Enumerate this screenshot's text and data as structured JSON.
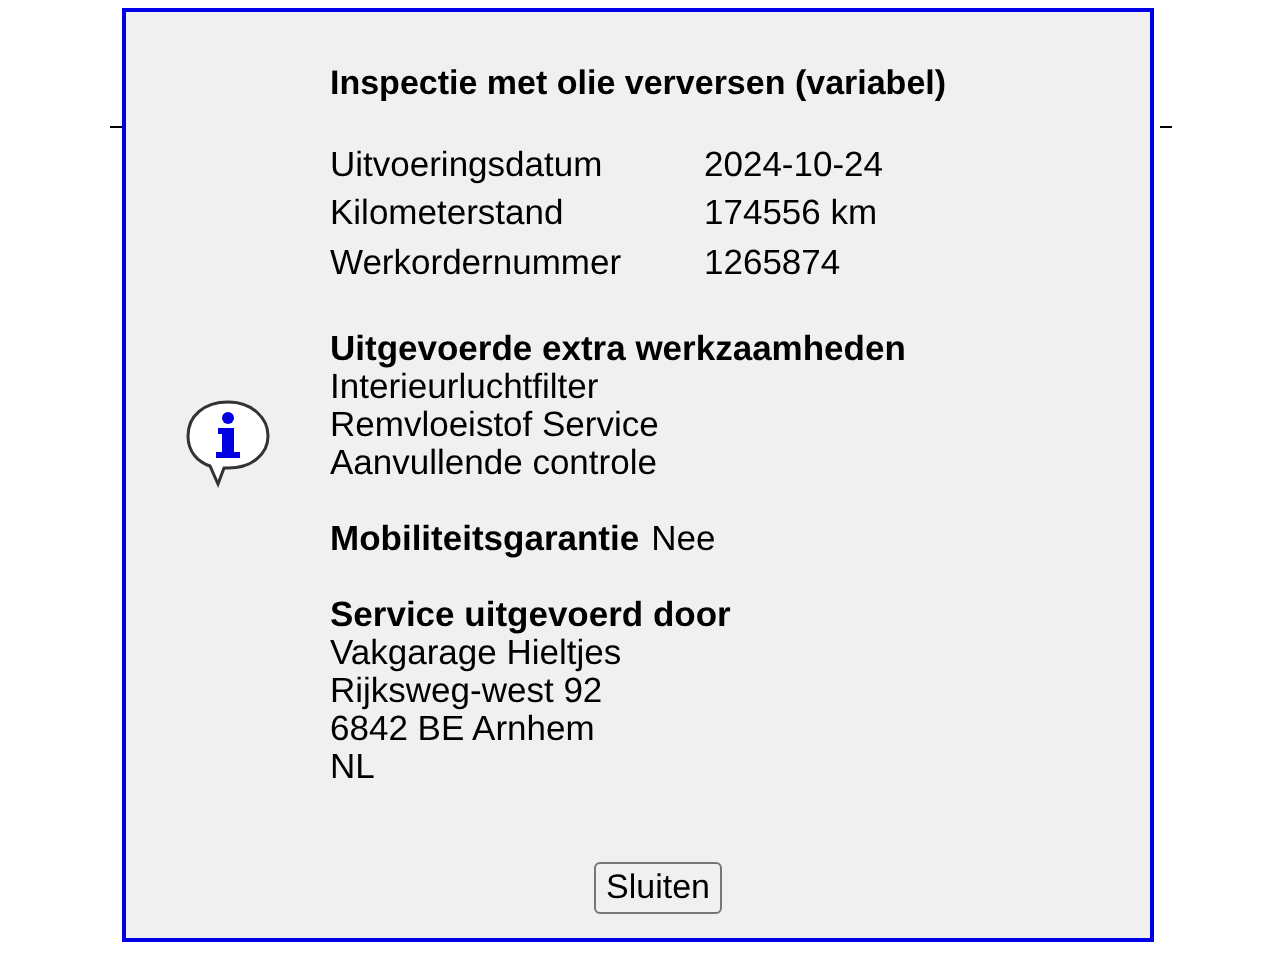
{
  "dialog": {
    "title": "Inspectie met olie verversen (variabel)",
    "details": [
      {
        "label": "Uitvoeringsdatum",
        "value": "2024-10-24"
      },
      {
        "label": "Kilometerstand",
        "value": "174556 km"
      },
      {
        "label": "Werkordernummer",
        "value": "1265874"
      }
    ],
    "extra_work": {
      "heading": "Uitgevoerde extra werkzaamheden",
      "items": [
        "Interieurluchtfilter",
        "Remvloeistof Service",
        "Aanvullende controle"
      ]
    },
    "mobility": {
      "label": "Mobiliteitsgarantie",
      "value": "Nee"
    },
    "service_by": {
      "heading": "Service uitgevoerd door",
      "lines": [
        "Vakgarage Hieltjes",
        "Rijksweg-west 92",
        "6842 BE Arnhem",
        "NL"
      ]
    },
    "buttons": [
      "Sluiten"
    ]
  }
}
